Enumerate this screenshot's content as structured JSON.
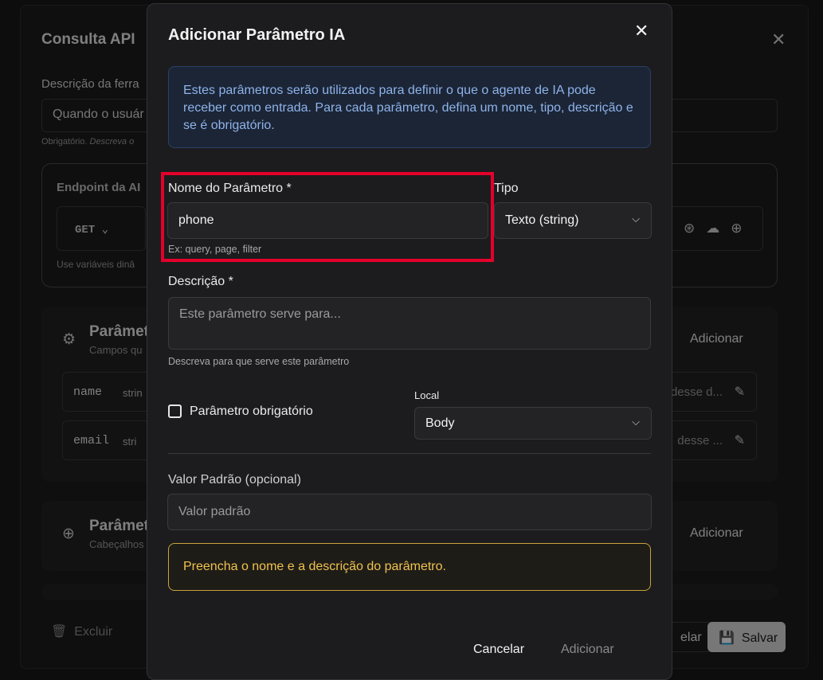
{
  "background": {
    "title": "Consulta API",
    "description_label": "Descrição da ferra",
    "description_value": "Quando o usuár",
    "description_hint_prefix": "Obrigatório.",
    "description_hint_italic": "Descreva o",
    "endpoint_title": "Endpoint da AI",
    "method": "GET",
    "endpoint_hint": "Use variáveis dinâ",
    "params_section": {
      "title": "Parâmet",
      "subtitle": "Campos qu",
      "add_label": "Adicionar",
      "rows": [
        {
          "name": "name",
          "type": "strin",
          "desc": "desse d..."
        },
        {
          "name": "email",
          "type": "stri",
          "desc": "desse ..."
        }
      ]
    },
    "headers_section": {
      "title": "Parâmet",
      "subtitle": "Cabeçalhos",
      "add_label": "Adicionar"
    },
    "delete_label": "Excluir",
    "cancel_label": "elar",
    "save_label": "Salvar"
  },
  "modal": {
    "title": "Adicionar Parâmetro IA",
    "info_text": "Estes parâmetros serão utilizados para definir o que o agente de IA pode receber como entrada. Para cada parâmetro, defina um nome, tipo, descrição e se é obrigatório.",
    "name_label": "Nome do Parâmetro *",
    "name_value": "phone",
    "name_hint": "Ex: query, page, filter",
    "type_label": "Tipo",
    "type_value": "Texto (string)",
    "description_label": "Descrição *",
    "description_placeholder": "Este parâmetro serve para...",
    "description_hint": "Descreva para que serve este parâmetro",
    "required_label": "Parâmetro obrigatório",
    "required_checked": false,
    "location_label": "Local",
    "location_value": "Body",
    "default_label": "Valor Padrão (opcional)",
    "default_placeholder": "Valor padrão",
    "warning_text": "Preencha o nome e a descrição do parâmetro.",
    "cancel_label": "Cancelar",
    "add_label": "Adicionar"
  },
  "colors": {
    "highlight": "#e4002b",
    "info": "#8fb3ea",
    "warning": "#f0c24f"
  }
}
